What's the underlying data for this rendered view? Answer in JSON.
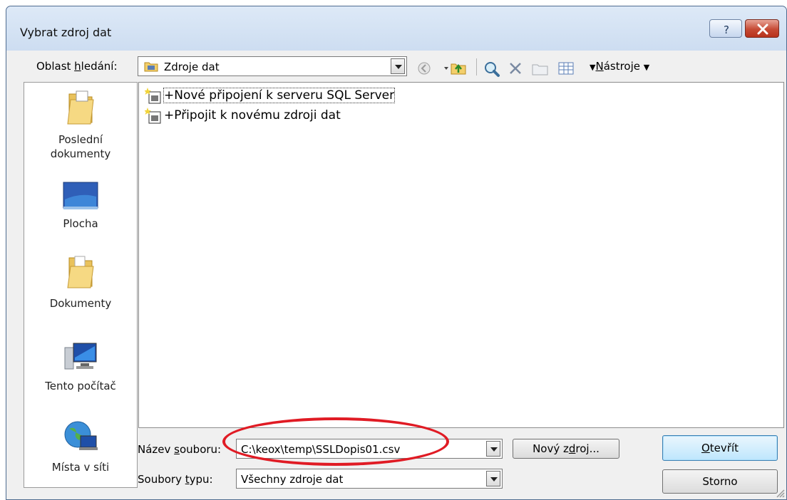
{
  "window": {
    "title": "Vybrat zdroj dat",
    "help_label": "?",
    "close_label": "×"
  },
  "lookin": {
    "label_pre": "Oblast ",
    "label_underlined": "h",
    "label_post": "ledání:",
    "value": "Zdroje dat"
  },
  "toolbar": {
    "tools_label": "Nástroje",
    "tools_underlined": "N",
    "tools_rest": "ástroje"
  },
  "places": [
    {
      "label_line1": "Poslední",
      "label_line2": "dokumenty",
      "icon": "recent-folder-icon"
    },
    {
      "label_line1": "Plocha",
      "label_line2": "",
      "icon": "desktop-icon"
    },
    {
      "label_line1": "Dokumenty",
      "label_line2": "",
      "icon": "documents-folder-icon"
    },
    {
      "label_line1": "Tento počítač",
      "label_line2": "",
      "icon": "computer-icon"
    },
    {
      "label_line1": "Místa v síti",
      "label_line2": "",
      "icon": "network-icon"
    }
  ],
  "files": [
    {
      "name": "+Nové připojení k serveru SQL Server",
      "icon": "new-data-source-icon"
    },
    {
      "name": "+Připojit k novému zdroji dat",
      "icon": "new-data-source-icon"
    }
  ],
  "filename": {
    "label_pre": "Název ",
    "label_underlined": "s",
    "label_post": "ouboru:",
    "value": "C:\\keox\\temp\\SSLDopis01.csv"
  },
  "filetype": {
    "label_pre": "Soubory ",
    "label_underlined": "t",
    "label_post": "ypu:",
    "value": "Všechny zdroje dat"
  },
  "buttons": {
    "new_source_pre": "Nový z",
    "new_source_underlined": "d",
    "new_source_post": "roj...",
    "open_underlined": "O",
    "open_post": "tevřít",
    "cancel": "Storno"
  },
  "colors": {
    "annotation": "#e01b24",
    "title_bg": "#cdddf1",
    "close": "#c64a34"
  }
}
